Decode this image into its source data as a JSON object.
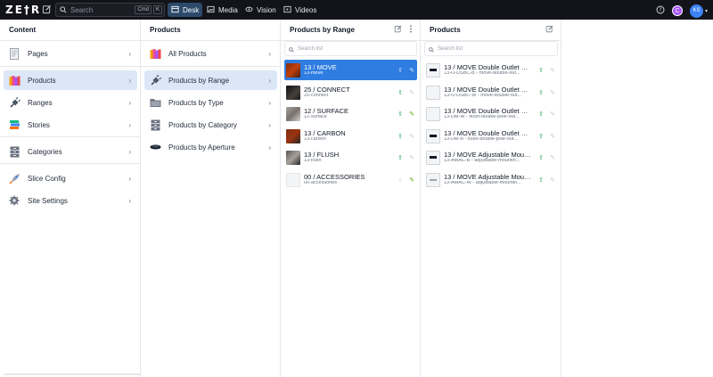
{
  "topbar": {
    "logo": "ZE†R",
    "search_placeholder": "Search",
    "shortcut_cmd": "Cmd",
    "shortcut_key": "K",
    "tabs": [
      {
        "label": "Desk",
        "icon": "desk-icon"
      },
      {
        "label": "Media",
        "icon": "media-icon"
      },
      {
        "label": "Vision",
        "icon": "eye-icon"
      },
      {
        "label": "Videos",
        "icon": "play-icon"
      }
    ],
    "active_tab": "Desk",
    "avatar_c": "C",
    "avatar_user": "KS"
  },
  "content": {
    "title": "Content",
    "items": [
      {
        "label": "Pages"
      },
      {
        "label": "Products"
      },
      {
        "label": "Ranges"
      },
      {
        "label": "Stories"
      },
      {
        "label": "Categories"
      },
      {
        "label": "Slice Config"
      },
      {
        "label": "Site Settings"
      }
    ]
  },
  "products": {
    "title": "Products",
    "items": [
      {
        "label": "All Products"
      },
      {
        "label": "Products by Range"
      },
      {
        "label": "Products by Type"
      },
      {
        "label": "Products by Category"
      },
      {
        "label": "Products by Aperture"
      }
    ]
  },
  "by_range": {
    "title": "Products by Range",
    "search_placeholder": "Search list",
    "items": [
      {
        "title": "13 / MOVE",
        "slug": "13-move"
      },
      {
        "title": "25 / CONNECT",
        "slug": "25-connect"
      },
      {
        "title": "12 / SURFACE",
        "slug": "12-surface"
      },
      {
        "title": "13 / CARBON",
        "slug": "13-carbon"
      },
      {
        "title": "13 / FLUSH",
        "slug": "13-flush"
      },
      {
        "title": "00 / ACCESSORIES",
        "slug": "00-accessories"
      }
    ]
  },
  "list": {
    "title": "Products",
    "search_placeholder": "Search list",
    "items": [
      {
        "title": "13 / MOVE Double Outlet US...",
        "slug": "13-O-USBC-B - move-double-out..."
      },
      {
        "title": "13 / MOVE Double Outlet US...",
        "slug": "13-O-USBC-W - move-double-out..."
      },
      {
        "title": "13 / MOVE Double Outlet Ma...",
        "slug": "13-DM-W - flush-double-pole-out..."
      },
      {
        "title": "13 / MOVE Double Outlet Ma...",
        "slug": "13-DM-B - flush-double-pole-out..."
      },
      {
        "title": "13 / MOVE Adjustable Mount...",
        "slug": "13-AMAC-B - adjustable-mountin..."
      },
      {
        "title": "13 / MOVE Adjustable Mount...",
        "slug": "13-AMAC-W - adjustable-mountin..."
      }
    ]
  }
}
